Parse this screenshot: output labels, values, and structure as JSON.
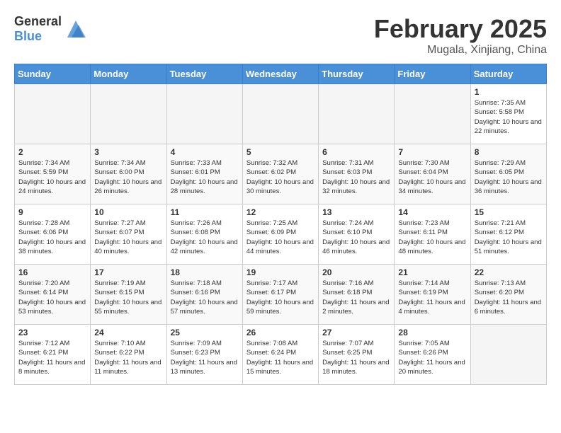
{
  "header": {
    "logo_general": "General",
    "logo_blue": "Blue",
    "month": "February 2025",
    "location": "Mugala, Xinjiang, China"
  },
  "weekdays": [
    "Sunday",
    "Monday",
    "Tuesday",
    "Wednesday",
    "Thursday",
    "Friday",
    "Saturday"
  ],
  "weeks": [
    [
      {
        "day": "",
        "info": ""
      },
      {
        "day": "",
        "info": ""
      },
      {
        "day": "",
        "info": ""
      },
      {
        "day": "",
        "info": ""
      },
      {
        "day": "",
        "info": ""
      },
      {
        "day": "",
        "info": ""
      },
      {
        "day": "1",
        "info": "Sunrise: 7:35 AM\nSunset: 5:58 PM\nDaylight: 10 hours and 22 minutes."
      }
    ],
    [
      {
        "day": "2",
        "info": "Sunrise: 7:34 AM\nSunset: 5:59 PM\nDaylight: 10 hours and 24 minutes."
      },
      {
        "day": "3",
        "info": "Sunrise: 7:34 AM\nSunset: 6:00 PM\nDaylight: 10 hours and 26 minutes."
      },
      {
        "day": "4",
        "info": "Sunrise: 7:33 AM\nSunset: 6:01 PM\nDaylight: 10 hours and 28 minutes."
      },
      {
        "day": "5",
        "info": "Sunrise: 7:32 AM\nSunset: 6:02 PM\nDaylight: 10 hours and 30 minutes."
      },
      {
        "day": "6",
        "info": "Sunrise: 7:31 AM\nSunset: 6:03 PM\nDaylight: 10 hours and 32 minutes."
      },
      {
        "day": "7",
        "info": "Sunrise: 7:30 AM\nSunset: 6:04 PM\nDaylight: 10 hours and 34 minutes."
      },
      {
        "day": "8",
        "info": "Sunrise: 7:29 AM\nSunset: 6:05 PM\nDaylight: 10 hours and 36 minutes."
      }
    ],
    [
      {
        "day": "9",
        "info": "Sunrise: 7:28 AM\nSunset: 6:06 PM\nDaylight: 10 hours and 38 minutes."
      },
      {
        "day": "10",
        "info": "Sunrise: 7:27 AM\nSunset: 6:07 PM\nDaylight: 10 hours and 40 minutes."
      },
      {
        "day": "11",
        "info": "Sunrise: 7:26 AM\nSunset: 6:08 PM\nDaylight: 10 hours and 42 minutes."
      },
      {
        "day": "12",
        "info": "Sunrise: 7:25 AM\nSunset: 6:09 PM\nDaylight: 10 hours and 44 minutes."
      },
      {
        "day": "13",
        "info": "Sunrise: 7:24 AM\nSunset: 6:10 PM\nDaylight: 10 hours and 46 minutes."
      },
      {
        "day": "14",
        "info": "Sunrise: 7:23 AM\nSunset: 6:11 PM\nDaylight: 10 hours and 48 minutes."
      },
      {
        "day": "15",
        "info": "Sunrise: 7:21 AM\nSunset: 6:12 PM\nDaylight: 10 hours and 51 minutes."
      }
    ],
    [
      {
        "day": "16",
        "info": "Sunrise: 7:20 AM\nSunset: 6:14 PM\nDaylight: 10 hours and 53 minutes."
      },
      {
        "day": "17",
        "info": "Sunrise: 7:19 AM\nSunset: 6:15 PM\nDaylight: 10 hours and 55 minutes."
      },
      {
        "day": "18",
        "info": "Sunrise: 7:18 AM\nSunset: 6:16 PM\nDaylight: 10 hours and 57 minutes."
      },
      {
        "day": "19",
        "info": "Sunrise: 7:17 AM\nSunset: 6:17 PM\nDaylight: 10 hours and 59 minutes."
      },
      {
        "day": "20",
        "info": "Sunrise: 7:16 AM\nSunset: 6:18 PM\nDaylight: 11 hours and 2 minutes."
      },
      {
        "day": "21",
        "info": "Sunrise: 7:14 AM\nSunset: 6:19 PM\nDaylight: 11 hours and 4 minutes."
      },
      {
        "day": "22",
        "info": "Sunrise: 7:13 AM\nSunset: 6:20 PM\nDaylight: 11 hours and 6 minutes."
      }
    ],
    [
      {
        "day": "23",
        "info": "Sunrise: 7:12 AM\nSunset: 6:21 PM\nDaylight: 11 hours and 8 minutes."
      },
      {
        "day": "24",
        "info": "Sunrise: 7:10 AM\nSunset: 6:22 PM\nDaylight: 11 hours and 11 minutes."
      },
      {
        "day": "25",
        "info": "Sunrise: 7:09 AM\nSunset: 6:23 PM\nDaylight: 11 hours and 13 minutes."
      },
      {
        "day": "26",
        "info": "Sunrise: 7:08 AM\nSunset: 6:24 PM\nDaylight: 11 hours and 15 minutes."
      },
      {
        "day": "27",
        "info": "Sunrise: 7:07 AM\nSunset: 6:25 PM\nDaylight: 11 hours and 18 minutes."
      },
      {
        "day": "28",
        "info": "Sunrise: 7:05 AM\nSunset: 6:26 PM\nDaylight: 11 hours and 20 minutes."
      },
      {
        "day": "",
        "info": ""
      }
    ]
  ]
}
